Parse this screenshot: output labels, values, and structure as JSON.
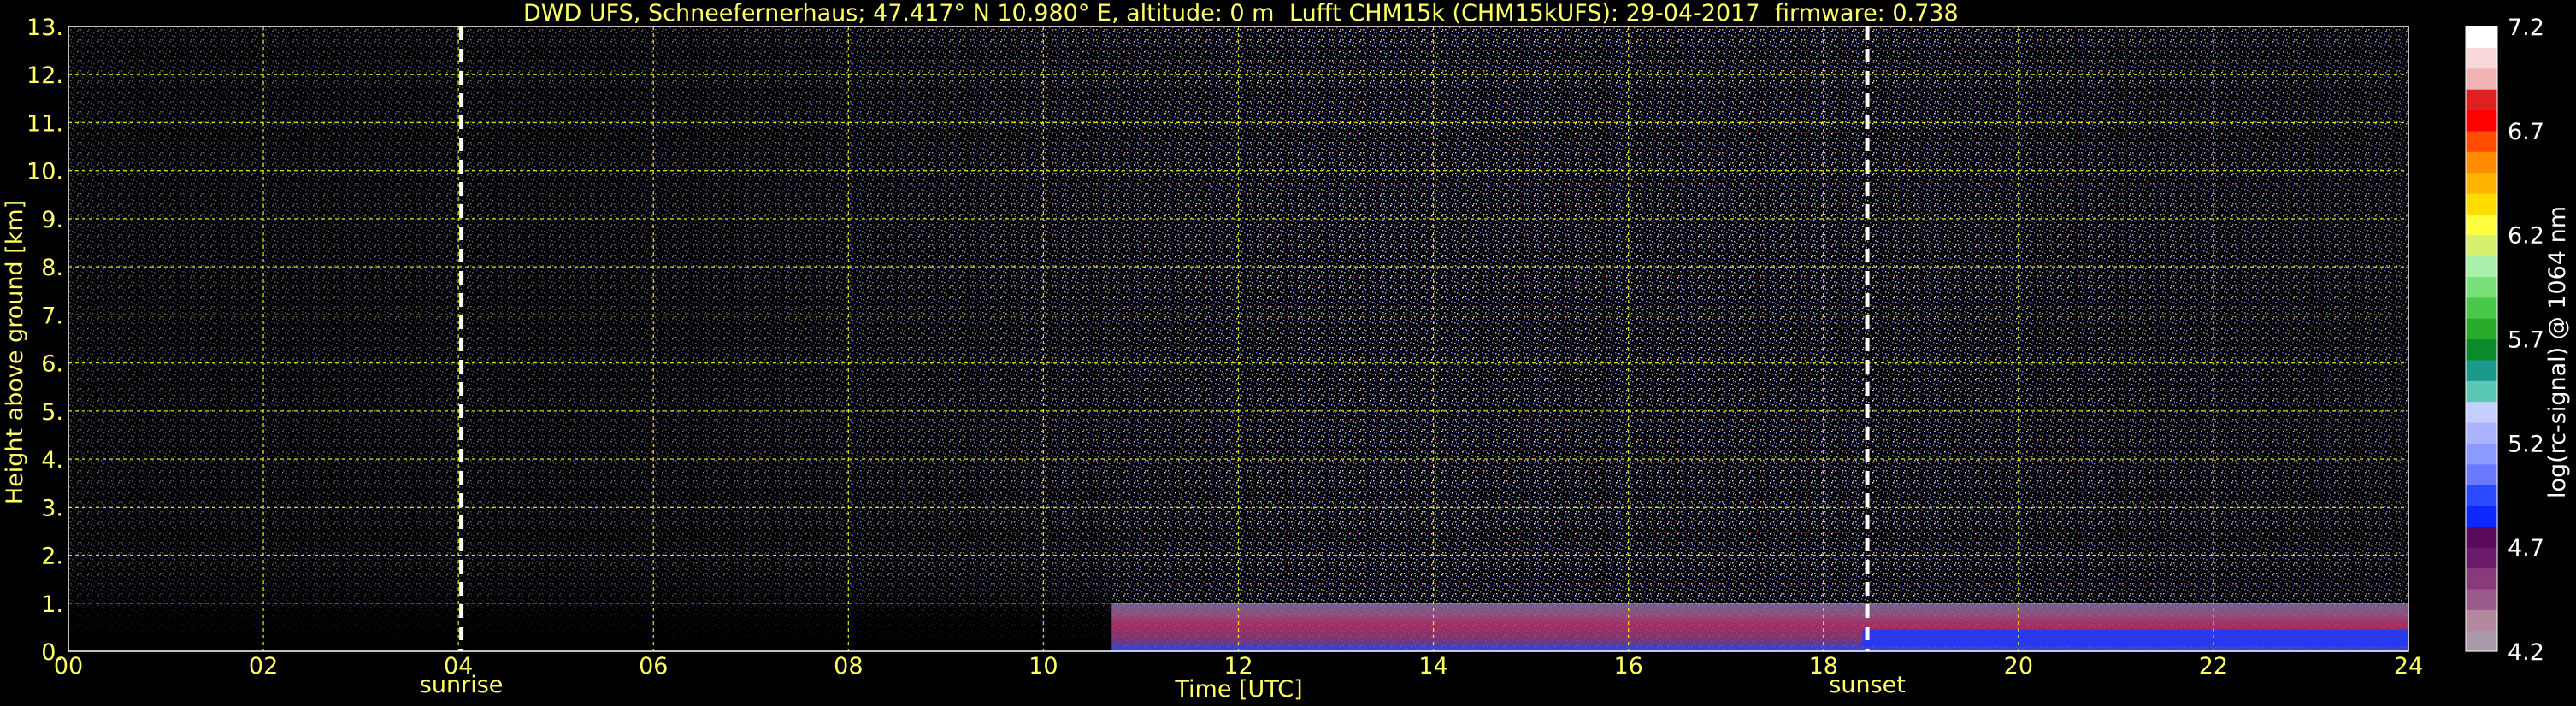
{
  "chart_data": {
    "type": "heatmap",
    "title_parts": [
      "DWD UFS, Schneefernerhaus; 47.417° N 10.980° E, altitude: 0 m",
      "Lufft CHM15k (CHM15kUFS): 29-04-2017",
      "firmware: 0.738"
    ],
    "xlabel": "Time [UTC]",
    "ylabel": "Height above ground [km]",
    "xlim": [
      0,
      24
    ],
    "ylim": [
      0,
      13
    ],
    "x_ticks": [
      "00",
      "02",
      "04",
      "06",
      "08",
      "10",
      "12",
      "14",
      "16",
      "18",
      "20",
      "22",
      "24"
    ],
    "y_ticks": [
      "0.",
      "1.",
      "2.",
      "3.",
      "4.",
      "5.",
      "6.",
      "7.",
      "8.",
      "9.",
      "10.",
      "11.",
      "12.",
      "13."
    ],
    "grid": true,
    "events": [
      {
        "name": "sunrise",
        "x": 4.03
      },
      {
        "name": "sunset",
        "x": 18.45
      }
    ],
    "colorbar": {
      "label": "log(rc-signal) @ 1064 nm",
      "range": [
        4.2,
        7.2
      ],
      "ticks": [
        "4.2",
        "4.7",
        "5.2",
        "5.7",
        "6.2",
        "6.7",
        "7.2"
      ],
      "colors": [
        "#a89aa8",
        "#b4889e",
        "#9a5a8a",
        "#8a3a7a",
        "#6a1a6a",
        "#5a0a5a",
        "#0a28ff",
        "#2a4aff",
        "#6a7aff",
        "#8a9aff",
        "#aab4ff",
        "#c6ceff",
        "#5ac8b4",
        "#1a9a8a",
        "#0a8a2a",
        "#2aaa2a",
        "#4ac84a",
        "#7ae07a",
        "#aaf0aa",
        "#d8f070",
        "#ffff40",
        "#ffdc00",
        "#ffb400",
        "#ff8c00",
        "#ff4c00",
        "#ff0000",
        "#e02020",
        "#f0b4b4",
        "#f8d8d8",
        "#ffffff"
      ]
    },
    "regions": [
      {
        "desc": "noise",
        "x": [
          0,
          24
        ],
        "y": [
          0,
          13
        ]
      },
      {
        "desc": "boundary_layer",
        "x": [
          10.7,
          24
        ],
        "y": [
          0,
          1.0
        ]
      },
      {
        "desc": "strong_layer",
        "x": [
          18.4,
          24
        ],
        "y": [
          0.1,
          0.45
        ]
      }
    ]
  }
}
